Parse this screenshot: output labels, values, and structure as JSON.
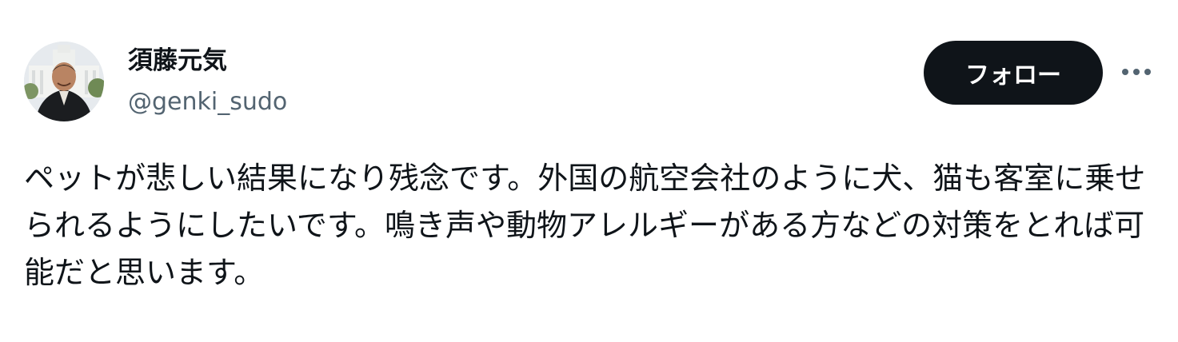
{
  "author": {
    "display_name": "須藤元気",
    "handle": "@genki_sudo",
    "avatar_icon": "profile-photo"
  },
  "actions": {
    "follow_label": "フォロー",
    "more_icon": "more-horizontal-icon"
  },
  "tweet": {
    "text": "ペットが悲しい結果になり残念です。外国の航空会社のように犬、猫も客室に乗せられるようにしたいです。鳴き声や動物アレルギーがある方などの対策をとれば可能だと思います。"
  },
  "colors": {
    "text_primary": "#0f1419",
    "text_secondary": "#536471",
    "button_bg": "#0f1419",
    "button_text": "#ffffff",
    "background": "#ffffff"
  }
}
